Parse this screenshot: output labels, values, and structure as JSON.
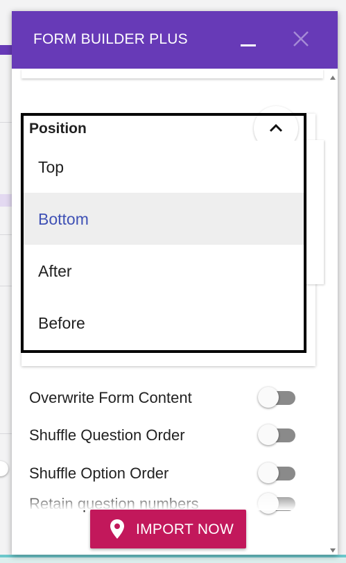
{
  "panel": {
    "title": "FORM BUILDER PLUS"
  },
  "position": {
    "label": "Position",
    "options": [
      {
        "label": "Top",
        "selected": false
      },
      {
        "label": "Bottom",
        "selected": true
      },
      {
        "label": "After",
        "selected": false
      },
      {
        "label": "Before",
        "selected": false
      }
    ]
  },
  "settings": [
    {
      "label": "Overwrite Form Content",
      "on": false
    },
    {
      "label": "Shuffle Question Order",
      "on": false
    },
    {
      "label": "Shuffle Option Order",
      "on": false
    },
    {
      "label": "Retain question numbers",
      "on": false
    }
  ],
  "import_button": {
    "label": "IMPORT NOW"
  },
  "colors": {
    "header": "#673ab7",
    "import_button": "#c2185b",
    "selected_text": "#3f51b5",
    "selected_bg": "#eeeeee"
  },
  "icons": {
    "minimize": "minimize-icon",
    "close": "close-icon",
    "collapse": "chevron-up-icon",
    "import": "location-pin-icon"
  }
}
